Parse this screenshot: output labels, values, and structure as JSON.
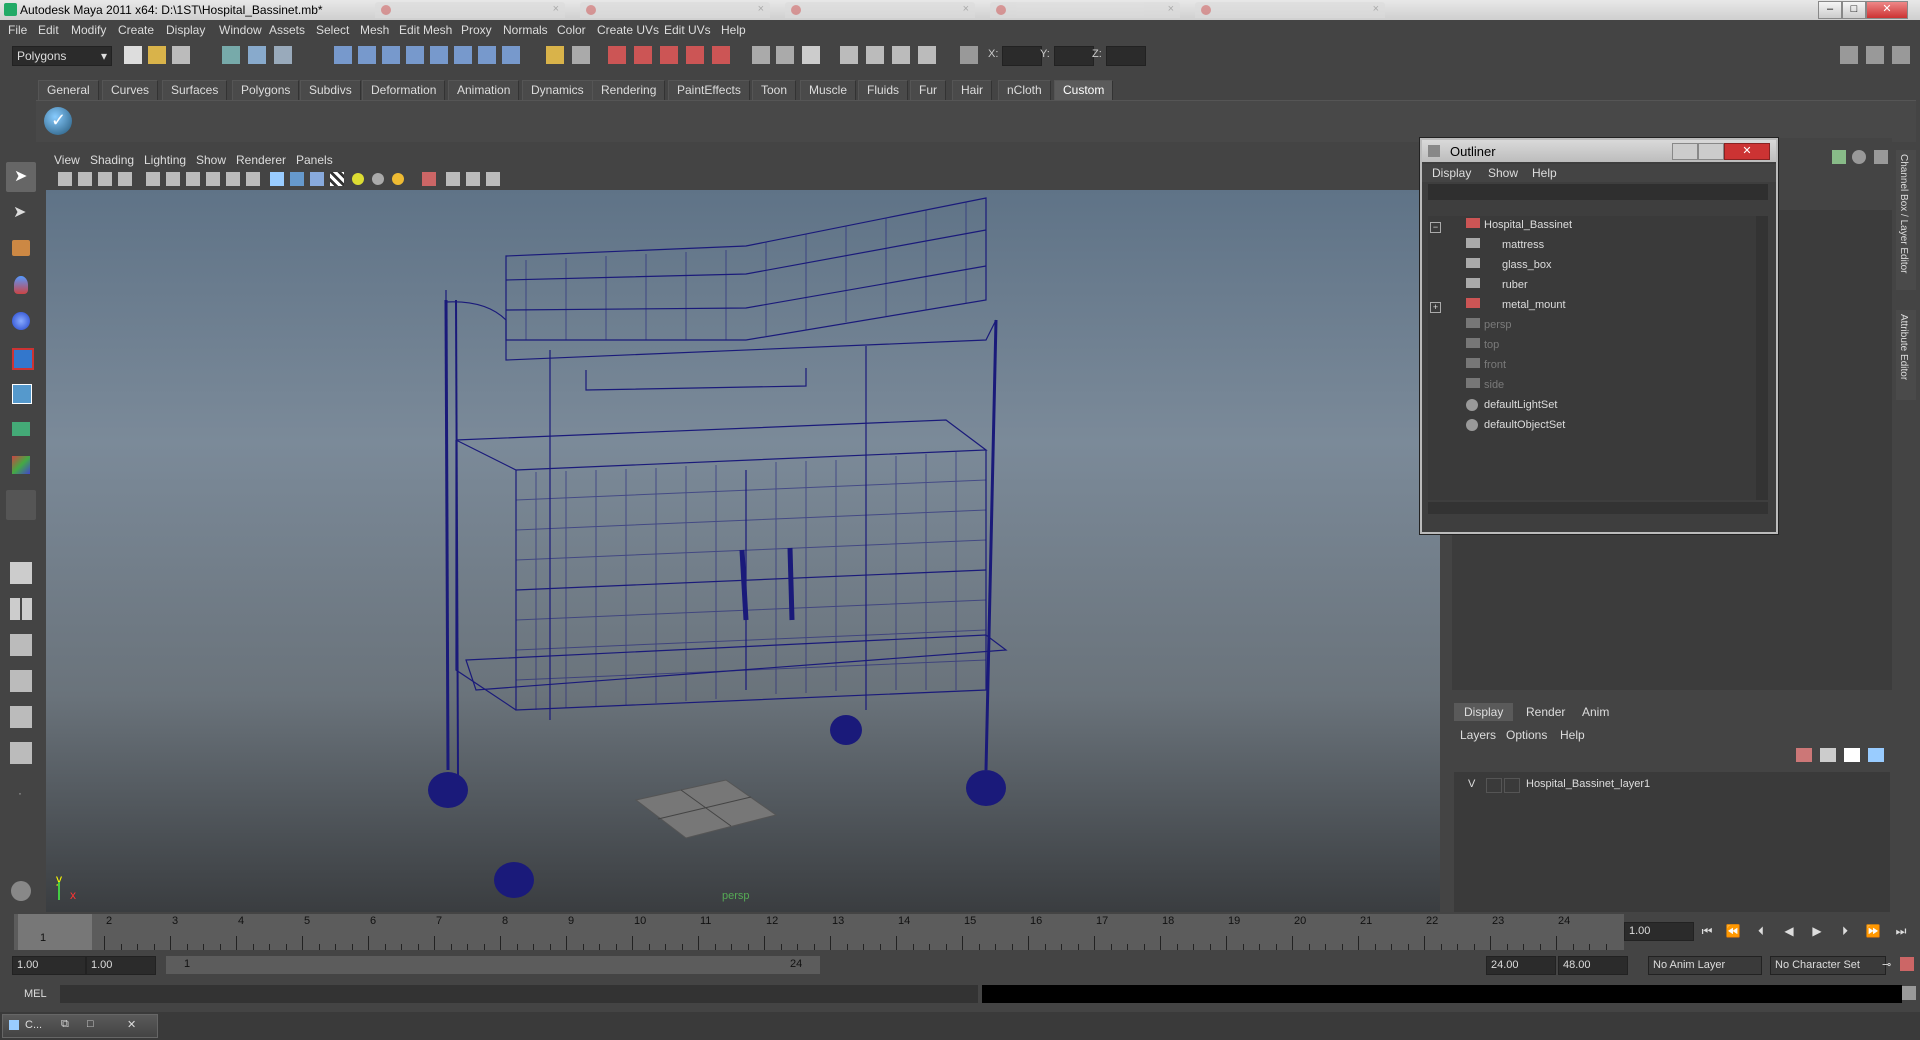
{
  "window": {
    "title": "Autodesk Maya 2011 x64: D:\\1ST\\Hospital_Bassinet.mb*"
  },
  "menubar": [
    "File",
    "Edit",
    "Modify",
    "Create",
    "Display",
    "Window",
    "Assets",
    "Select",
    "Mesh",
    "Edit Mesh",
    "Proxy",
    "Normals",
    "Color",
    "Create UVs",
    "Edit UVs",
    "Help"
  ],
  "statusline": {
    "mode": "Polygons",
    "x_label": "X:",
    "y_label": "Y:",
    "z_label": "Z:"
  },
  "shelf_tabs": [
    "General",
    "Curves",
    "Surfaces",
    "Polygons",
    "Subdivs",
    "Deformation",
    "Animation",
    "Dynamics",
    "Rendering",
    "PaintEffects",
    "Toon",
    "Muscle",
    "Fluids",
    "Fur",
    "Hair",
    "nCloth",
    "Custom"
  ],
  "shelf_active": "Custom",
  "viewport": {
    "menu": [
      "View",
      "Shading",
      "Lighting",
      "Show",
      "Renderer",
      "Panels"
    ],
    "camera_label": "persp",
    "axis_y": "y",
    "axis_x": "x",
    "wire_color": "#1a1a7a"
  },
  "outliner": {
    "title": "Outliner",
    "menu": [
      "Display",
      "Show",
      "Help"
    ],
    "items": [
      {
        "label": "Hospital_Bassinet",
        "dim": false
      },
      {
        "label": "mattress",
        "dim": false
      },
      {
        "label": "glass_box",
        "dim": false
      },
      {
        "label": "ruber",
        "dim": false
      },
      {
        "label": "metal_mount",
        "dim": false
      },
      {
        "label": "persp",
        "dim": true
      },
      {
        "label": "top",
        "dim": true
      },
      {
        "label": "front",
        "dim": true
      },
      {
        "label": "side",
        "dim": true
      },
      {
        "label": "defaultLightSet",
        "dim": false
      },
      {
        "label": "defaultObjectSet",
        "dim": false
      }
    ]
  },
  "side_tabs": {
    "channel_box": "Channel Box / Layer Editor",
    "attribute_editor": "Attribute Editor"
  },
  "layer_editor": {
    "tabs": [
      "Display",
      "Render",
      "Anim"
    ],
    "menu": [
      "Layers",
      "Options",
      "Help"
    ],
    "layer_visibility": "V",
    "layer_name": "Hospital_Bassinet_layer1"
  },
  "timeline": {
    "ticks": [
      "1",
      "2",
      "3",
      "4",
      "5",
      "6",
      "7",
      "8",
      "9",
      "10",
      "11",
      "12",
      "13",
      "14",
      "15",
      "16",
      "17",
      "18",
      "19",
      "20",
      "21",
      "22",
      "23",
      "24"
    ],
    "current_frame_marker": "1",
    "current_time": "1.00"
  },
  "range": {
    "start": "1.00",
    "playback_start": "1.00",
    "slider_start": "1",
    "slider_end": "24",
    "playback_end": "24.00",
    "end": "48.00",
    "anim_layer": "No Anim Layer",
    "character_set": "No Character Set"
  },
  "cmdline": {
    "label": "MEL"
  },
  "taskbar": {
    "item": "C..."
  },
  "colors": {
    "ui_bg": "#444444",
    "accent_shelf": "#5b5b5b"
  }
}
